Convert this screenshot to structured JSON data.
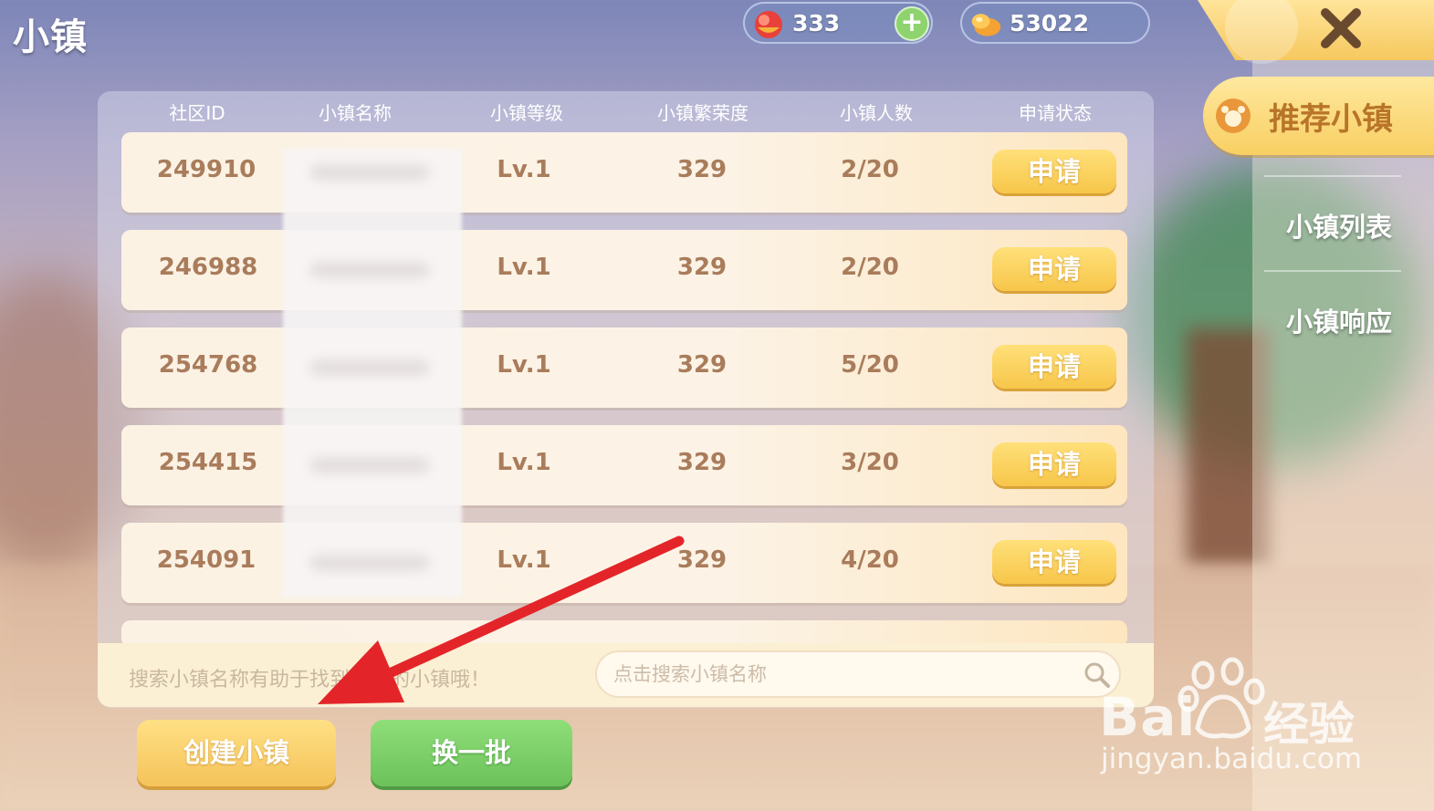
{
  "page_title": "小镇",
  "currency": {
    "gems": "333",
    "coins": "53022"
  },
  "sidebar": {
    "recommended": "推荐小镇",
    "items": [
      {
        "label": "小镇列表"
      },
      {
        "label": "小镇响应"
      }
    ]
  },
  "table": {
    "headers": [
      "社区ID",
      "小镇名称",
      "小镇等级",
      "小镇繁荣度",
      "小镇人数",
      "申请状态"
    ],
    "rows": [
      {
        "id": "249910",
        "name": "",
        "level": "Lv.1",
        "prosperity": "329",
        "members": "2/20",
        "action": "申请"
      },
      {
        "id": "246988",
        "name": "",
        "level": "Lv.1",
        "prosperity": "329",
        "members": "2/20",
        "action": "申请"
      },
      {
        "id": "254768",
        "name": "",
        "level": "Lv.1",
        "prosperity": "329",
        "members": "5/20",
        "action": "申请"
      },
      {
        "id": "254415",
        "name": "",
        "level": "Lv.1",
        "prosperity": "329",
        "members": "3/20",
        "action": "申请"
      },
      {
        "id": "254091",
        "name": "",
        "level": "Lv.1",
        "prosperity": "329",
        "members": "4/20",
        "action": "申请"
      }
    ]
  },
  "search": {
    "hint": "搜索小镇名称有助于找到自己的小镇哦！",
    "placeholder": "点击搜索小镇名称"
  },
  "buttons": {
    "create": "创建小镇",
    "refresh": "换一批"
  },
  "watermark": {
    "brand": "Bai",
    "brand_cn": "经验",
    "url": "jingyan.baidu.com"
  },
  "colors": {
    "accent_yellow": "#f7c64a",
    "accent_green": "#6cc25a",
    "text_brown": "#a97c5b",
    "arrow_red": "#e3252a"
  }
}
